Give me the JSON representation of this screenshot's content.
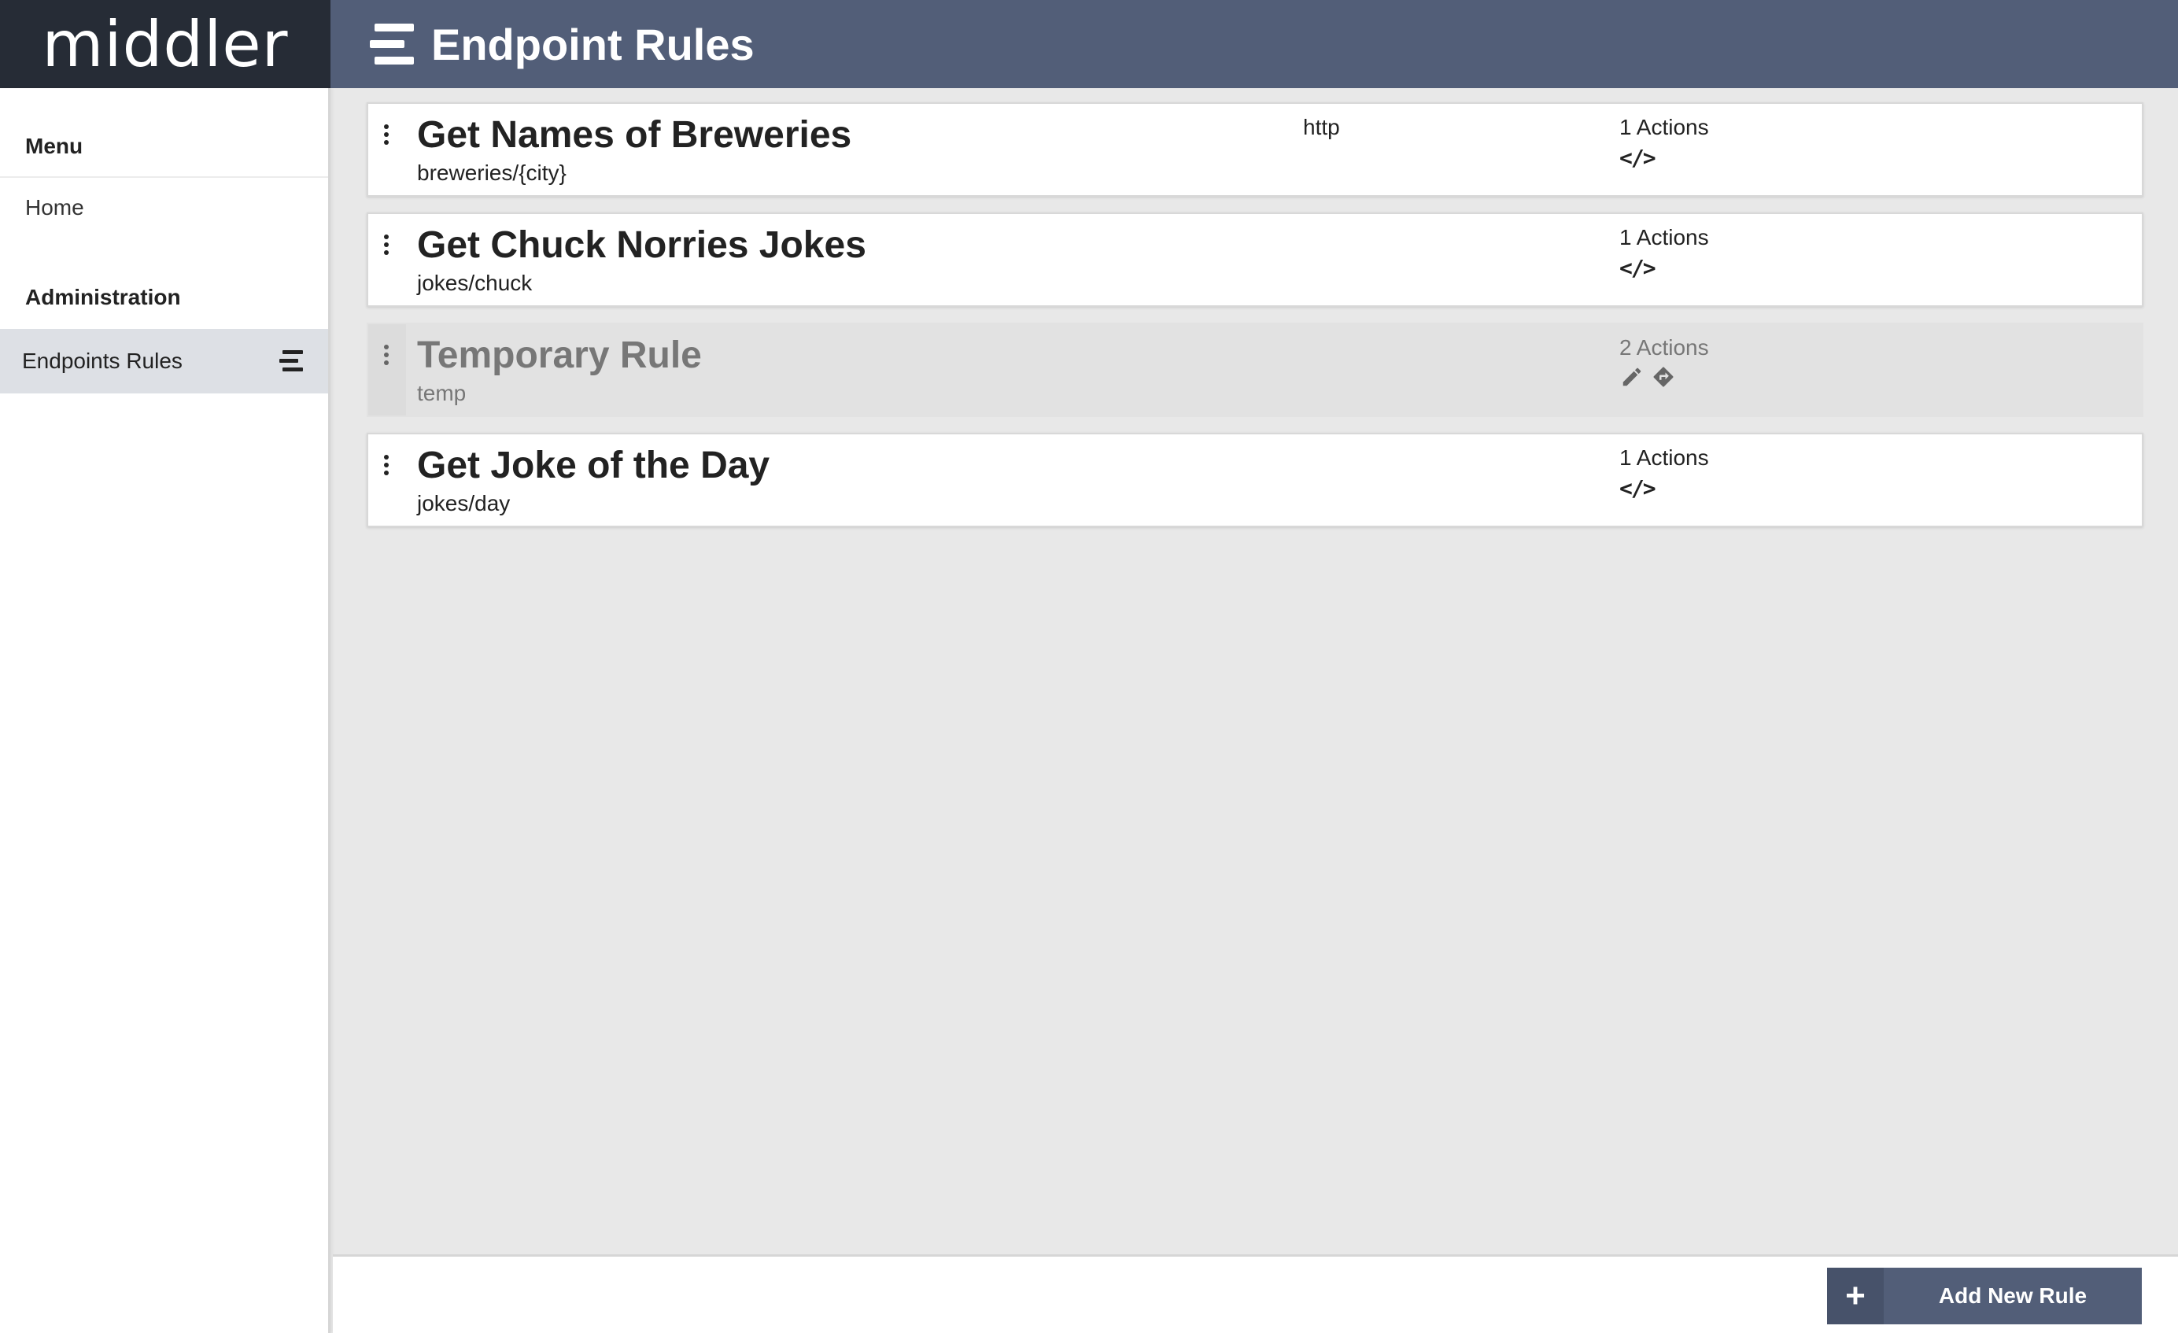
{
  "app": {
    "brand": "middler"
  },
  "header": {
    "title": "Endpoint Rules",
    "icon": "rules-icon"
  },
  "sidebar": {
    "menu_heading": "Menu",
    "home_label": "Home",
    "admin_heading": "Administration",
    "active_item": {
      "label": "Endpoints Rules",
      "icon": "rules-icon"
    }
  },
  "rules": [
    {
      "title": "Get Names of Breweries",
      "path": "breweries/{city}",
      "protocol": "http",
      "actions": "1 Actions",
      "action_icons": [
        "code-icon"
      ],
      "enabled": true
    },
    {
      "title": "Get Chuck Norries Jokes",
      "path": "jokes/chuck",
      "protocol": "",
      "actions": "1 Actions",
      "action_icons": [
        "code-icon"
      ],
      "enabled": true
    },
    {
      "title": "Temporary Rule",
      "path": "temp",
      "protocol": "",
      "actions": "2 Actions",
      "action_icons": [
        "pencil-icon",
        "directions-icon"
      ],
      "enabled": false
    },
    {
      "title": "Get Joke of the Day",
      "path": "jokes/day",
      "protocol": "",
      "actions": "1 Actions",
      "action_icons": [
        "code-icon"
      ],
      "enabled": true
    }
  ],
  "footer": {
    "add_button_label": "Add New Rule",
    "add_icon": "plus-icon"
  },
  "colors": {
    "header": "#525e78",
    "brand_bg": "#262c36",
    "content_bg": "#e8e8e8",
    "active_sidebar": "#dde0e5"
  }
}
